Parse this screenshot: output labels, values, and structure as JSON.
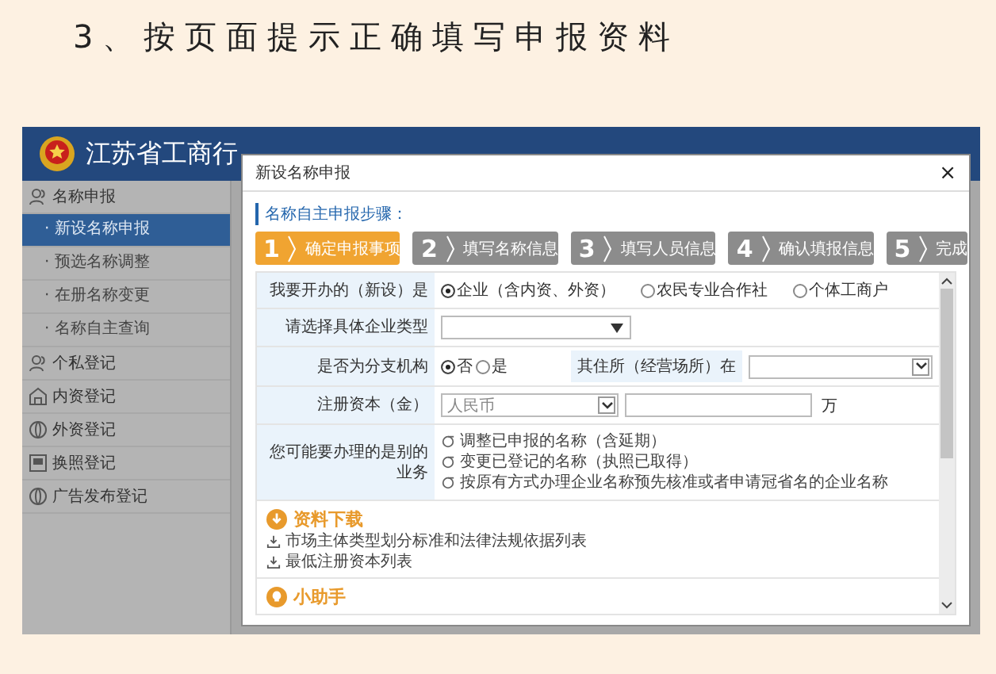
{
  "slide_title": "3、按页面提示正确填写申报资料",
  "app": {
    "header_title": "江苏省工商行",
    "sidebar": [
      {
        "label": "名称申报",
        "children": [
          {
            "label": "· 新设名称申报",
            "selected": true
          },
          {
            "label": "· 预选名称调整",
            "selected": false
          },
          {
            "label": "· 在册名称变更",
            "selected": false
          },
          {
            "label": "· 名称自主查询",
            "selected": false
          }
        ]
      },
      {
        "label": "个私登记"
      },
      {
        "label": "内资登记"
      },
      {
        "label": "外资登记"
      },
      {
        "label": "换照登记"
      },
      {
        "label": "广告发布登记"
      }
    ]
  },
  "modal": {
    "title": "新设名称申报",
    "close": "×",
    "steps_heading": "名称自主申报步骤：",
    "steps": [
      {
        "number": "1",
        "label": "确定申报事项",
        "selected": true
      },
      {
        "number": "2",
        "label": "填写名称信息",
        "selected": false
      },
      {
        "number": "3",
        "label": "填写人员信息",
        "selected": false
      },
      {
        "number": "4",
        "label": "确认填报信息",
        "selected": false
      },
      {
        "number": "5",
        "label": "完成",
        "selected": false
      }
    ],
    "rows": [
      {
        "kind": "radio",
        "label": "我要开办的（新设）是",
        "options": [
          {
            "label": "企业（含内资、外资）",
            "selected": true
          },
          {
            "label": "农民专业合作社",
            "selected": false
          },
          {
            "label": "个体工商户",
            "selected": false
          }
        ]
      },
      {
        "kind": "select",
        "label": "请选择具体企业类型"
      },
      {
        "kind": "split",
        "label": "是否为分支机构",
        "options": [
          {
            "label": "否",
            "selected": true
          },
          {
            "label": "是",
            "selected": false
          }
        ],
        "label_2": "其住所（经营场所）在"
      },
      {
        "kind": "capital",
        "label": "注册资本（金）",
        "currency": "人民币",
        "unit": "万"
      },
      {
        "kind": "links",
        "label": "您可能要办理的是别的业务",
        "links": [
          "调整已申报的名称（含延期）",
          "变更已登记的名称（执照已取得）",
          "按原有方式办理企业名称预先核准或者申请冠省名的企业名称"
        ]
      }
    ],
    "sections": [
      {
        "title": "资料下载",
        "links": [
          "市场主体类型划分标准和法律法规依据列表",
          "最低注册资本列表"
        ]
      },
      {
        "title": "小助手"
      }
    ]
  }
}
